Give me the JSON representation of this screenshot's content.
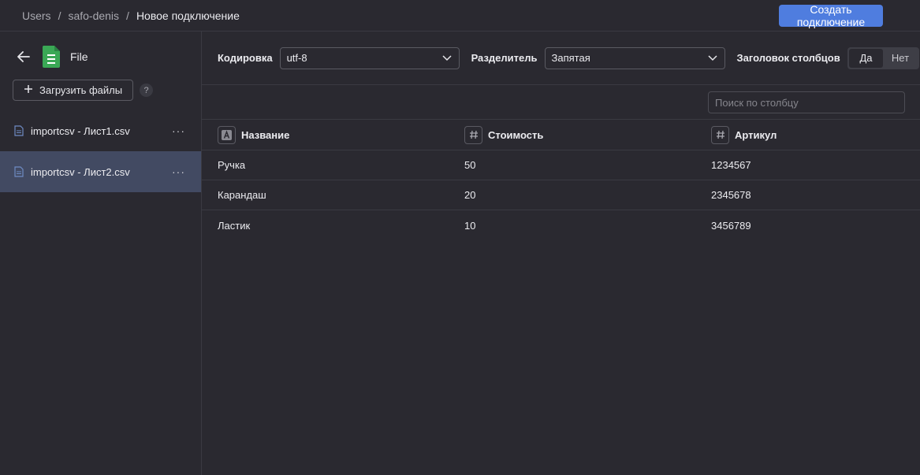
{
  "breadcrumbs": [
    "Users",
    "safo-denis",
    "Новое подключение"
  ],
  "header": {
    "create_button": "Создать подключение"
  },
  "sidebar": {
    "title": "File",
    "upload_button": "Загрузить файлы",
    "help": "?",
    "files": [
      {
        "name": "importcsv - Лист1.csv",
        "active": false
      },
      {
        "name": "importcsv - Лист2.csv",
        "active": true
      }
    ]
  },
  "options": {
    "encoding_label": "Кодировка",
    "encoding_value": "utf-8",
    "delimiter_label": "Разделитель",
    "delimiter_value": "Запятая",
    "header_label": "Заголовок столбцов",
    "header_yes": "Да",
    "header_no": "Нет",
    "header_selected": "Да"
  },
  "search": {
    "placeholder": "Поиск по столбцу"
  },
  "table": {
    "columns": [
      {
        "name": "Название",
        "type_icon": "A"
      },
      {
        "name": "Стоимость",
        "type_icon": "#"
      },
      {
        "name": "Артикул",
        "type_icon": "#"
      }
    ],
    "rows": [
      [
        "Ручка",
        "50",
        "1234567"
      ],
      [
        "Карандаш",
        "20",
        "2345678"
      ],
      [
        "Ластик",
        "10",
        "3456789"
      ]
    ]
  },
  "colors": {
    "accent": "#4f7ddf",
    "background": "#2a2930",
    "selected": "#424a62",
    "file_icon": "#3aa855"
  }
}
